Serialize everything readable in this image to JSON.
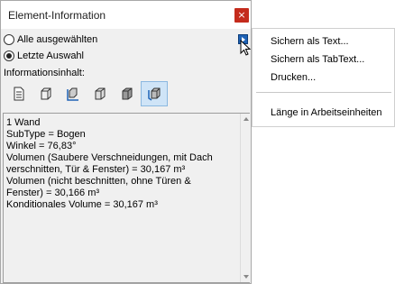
{
  "window": {
    "title": "Element-Information",
    "close_glyph": "×"
  },
  "selection": {
    "options": [
      {
        "label": "Alle ausgewählten",
        "checked": false
      },
      {
        "label": "Letzte Auswahl",
        "checked": true
      }
    ]
  },
  "info_content_label": "Informationsinhalt:",
  "tools": [
    {
      "icon": "document-icon",
      "active": false
    },
    {
      "icon": "box-outline-icon",
      "active": false
    },
    {
      "icon": "box-dimension-icon",
      "active": false
    },
    {
      "icon": "box-3d-icon",
      "active": false
    },
    {
      "icon": "box-cut-icon",
      "active": false
    },
    {
      "icon": "box-rotate-icon",
      "active": true
    }
  ],
  "info_text": {
    "lines": [
      "1 Wand",
      "SubType = Bogen",
      "Winkel = 76,83°",
      "Volumen (Saubere Verschneidungen, mit Dach",
      "verschnitten, Tür & Fenster) = 30,167 m³",
      "Volumen (nicht beschnitten, ohne Türen &",
      "Fenster) = 30,166 m³",
      "Konditionales Volume = 30,167 m³"
    ]
  },
  "context_menu": {
    "items": [
      "Sichern als Text...",
      "Sichern als TabText...",
      "Drucken...",
      "Länge in Arbeitseinheiten"
    ]
  },
  "colors": {
    "accent": "#1f63b6",
    "close": "#c42b1c",
    "active_tool": "#cfe4f7"
  }
}
